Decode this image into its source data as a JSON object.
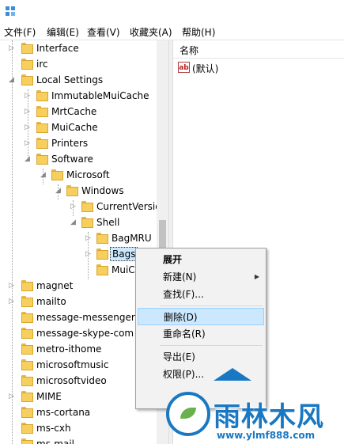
{
  "menubar": {
    "items": [
      "文件(F)",
      "编辑(E)",
      "查看(V)",
      "收藏夹(A)",
      "帮助(H)"
    ]
  },
  "tree": {
    "items": [
      {
        "label": "Interface"
      },
      {
        "label": "irc"
      },
      {
        "label": "Local Settings"
      },
      {
        "label": "ImmutableMuiCache"
      },
      {
        "label": "MrtCache"
      },
      {
        "label": "MuiCache"
      },
      {
        "label": "Printers"
      },
      {
        "label": "Software"
      },
      {
        "label": "Microsoft"
      },
      {
        "label": "Windows"
      },
      {
        "label": "CurrentVersio"
      },
      {
        "label": "Shell"
      },
      {
        "label": "BagMRU"
      },
      {
        "label": "Bags"
      },
      {
        "label": "MuiC"
      },
      {
        "label": "magnet"
      },
      {
        "label": "mailto"
      },
      {
        "label": "message-messenger"
      },
      {
        "label": "message-skype-com"
      },
      {
        "label": "metro-ithome"
      },
      {
        "label": "microsoftmusic"
      },
      {
        "label": "microsoftvideo"
      },
      {
        "label": "MIME"
      },
      {
        "label": "ms-cortana"
      },
      {
        "label": "ms-cxh"
      },
      {
        "label": "ms-mail"
      }
    ]
  },
  "right_pane": {
    "column_name": "名称",
    "value_icon": "ab",
    "value_name": "(默认)"
  },
  "context_menu": {
    "items": [
      "展开",
      "新建(N)",
      "查找(F)...",
      "删除(D)",
      "重命名(R)",
      "导出(E)",
      "权限(P)..."
    ]
  },
  "watermark": {
    "title": "雨林木风",
    "url": "www.ylmf888.com"
  },
  "colors": {
    "folder": "#f6cf5d",
    "selection": "#cce8ff",
    "watermark_blue": "#1a78c2"
  }
}
